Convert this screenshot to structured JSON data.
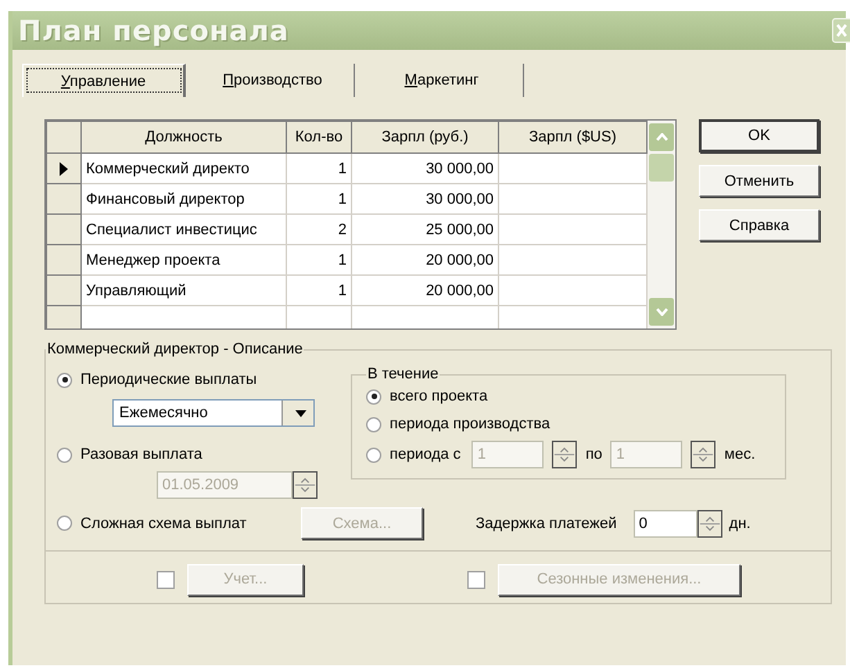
{
  "window": {
    "title": "План персонала"
  },
  "tabs": [
    {
      "label": "Управление",
      "selected": true
    },
    {
      "label": "Производство",
      "selected": false
    },
    {
      "label": "Маркетинг",
      "selected": false
    }
  ],
  "table": {
    "columns": [
      "Должность",
      "Кол-во",
      "Зарпл (руб.)",
      "Зарпл ($US)"
    ],
    "rows": [
      {
        "selected": true,
        "position": "Коммерческий директо",
        "count": "1",
        "salary_rub": "30 000,00"
      },
      {
        "selected": false,
        "position": "Финансовый директор",
        "count": "1",
        "salary_rub": "30 000,00"
      },
      {
        "selected": false,
        "position": "Специалист инвестицис",
        "count": "2",
        "salary_rub": "25 000,00"
      },
      {
        "selected": false,
        "position": "Менеджер проекта",
        "count": "1",
        "salary_rub": "20 000,00"
      },
      {
        "selected": false,
        "position": "Управляющий",
        "count": "1",
        "salary_rub": "20 000,00"
      }
    ]
  },
  "buttons": [
    "OK",
    "Отменить",
    "Справка"
  ],
  "description": {
    "title": "Коммерческий директор - Описание",
    "payment_options": [
      {
        "label": "Периодические выплаты",
        "selected": true
      },
      {
        "label": "Разовая выплата",
        "selected": false
      },
      {
        "label": "Сложная схема выплат",
        "selected": false
      }
    ],
    "frequency": {
      "value": "Ежемесячно"
    },
    "one_time_date": {
      "value": "01.05.2009",
      "disabled": true
    },
    "scheme_button": {
      "label": "Схема...",
      "disabled": true
    },
    "duration": {
      "title": "В течение",
      "options": [
        {
          "label": "всего проекта",
          "selected": true
        },
        {
          "label": "периода производства",
          "selected": false
        },
        {
          "label": "периода с",
          "selected": false
        }
      ],
      "from": {
        "value": "1",
        "disabled": true
      },
      "to_label": "по",
      "to": {
        "value": "1",
        "disabled": true
      },
      "unit": "мес."
    },
    "delay": {
      "label": "Задержка платежей",
      "value": "0",
      "unit": "дн."
    },
    "extras": [
      {
        "label": "Учет...",
        "checked": false,
        "disabled": true
      },
      {
        "label": "Сезонные изменения...",
        "checked": false,
        "disabled": true
      }
    ]
  }
}
